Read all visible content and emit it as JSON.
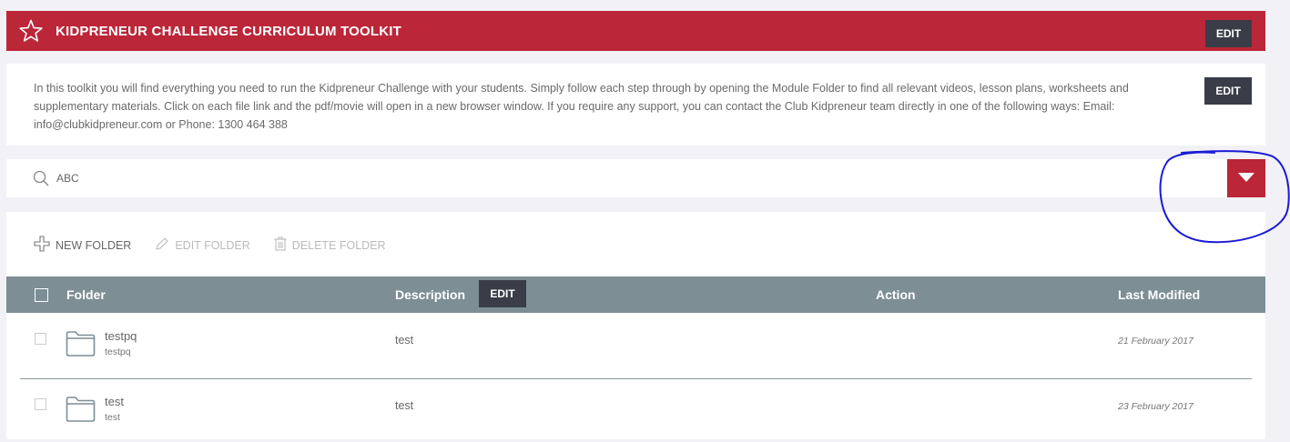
{
  "header": {
    "title": "KIDPRENEUR CHALLENGE CURRICULUM TOOLKIT",
    "edit_label": "EDIT"
  },
  "intro": {
    "text": "In this toolkit you will find everything you need to run the Kidpreneur Challenge with your students. Simply follow each step through by opening the Module Folder to find all relevant videos, lesson plans, worksheets and supplementary materials. Click on each file link and the pdf/movie will open in a new browser window. If you require any support, you can contact the Club Kidpreneur team directly in one of the following ways: Email: info@clubkidpreneur.com or Phone: 1300 464 388",
    "edit_label": "EDIT"
  },
  "search": {
    "value": "ABC"
  },
  "toolbar": {
    "new_folder": "NEW FOLDER",
    "edit_folder": "EDIT FOLDER",
    "delete_folder": "DELETE FOLDER"
  },
  "table": {
    "headers": {
      "folder": "Folder",
      "description": "Description",
      "description_edit": "EDIT",
      "action": "Action",
      "last_modified": "Last Modified"
    },
    "rows": [
      {
        "name": "testpq",
        "sub": "testpq",
        "description": "test",
        "modified": "21 February 2017"
      },
      {
        "name": "test",
        "sub": "test",
        "description": "test",
        "modified": "23 February 2017"
      }
    ]
  },
  "colors": {
    "brand_red": "#bb2638",
    "dark_button": "#3a3d48",
    "table_header": "#7d8e95",
    "annotation": "#1a1ad6"
  }
}
